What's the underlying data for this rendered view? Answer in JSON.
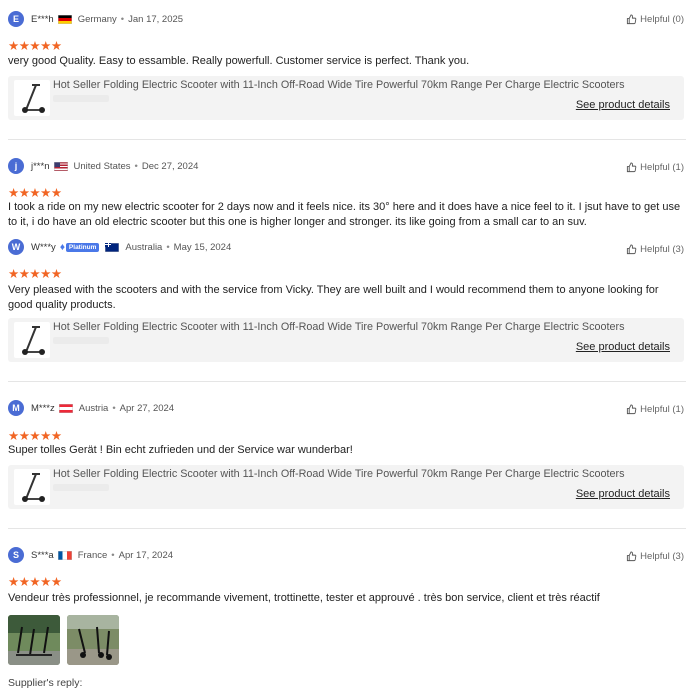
{
  "stars": "★★★★★",
  "colors": {
    "star": "#f16524",
    "avatar": "#4a6cd4",
    "platinum": "#4a78e8"
  },
  "product": {
    "title": "Hot Seller Folding Electric Scooter with 11-Inch Off-Road Wide Tire Powerful 70km Range Per Charge Electric Scooters",
    "details_link": "See product details"
  },
  "reviews": [
    {
      "initial": "E",
      "name": "E***h",
      "flag": "germany-flag",
      "country": "Germany",
      "date": "Jan 17, 2025",
      "helpful": "Helpful (0)",
      "rating": 5,
      "text": "very good Quality. Easy to essamble. Really powerfull. Customer service is perfect. Thank you."
    },
    {
      "initial": "j",
      "name": "j***n",
      "flag": "usa-flag",
      "country": "United States",
      "date": "Dec 27, 2024",
      "helpful": "Helpful (1)",
      "rating": 5,
      "text": "I took a ride on my new electric scooter for 2 days now and it feels nice. its 30° here and it does have a nice feel to it. I jsut have to get use to it, i do have an old electric scooter but this one is higher longer and stronger. its like going from a small car to an suv."
    },
    {
      "initial": "W",
      "name": "W***y",
      "badge": "Platinum",
      "flag": "australia-flag",
      "country": "Australia",
      "date": "May 15, 2024",
      "helpful": "Helpful (3)",
      "rating": 5,
      "text": "Very pleased with the scooters and with the service from Vicky. They are well built and I would recommend them to anyone looking for good quality products."
    },
    {
      "initial": "M",
      "name": "M***z",
      "flag": "austria-flag",
      "country": "Austria",
      "date": "Apr 27, 2024",
      "helpful": "Helpful (1)",
      "rating": 5,
      "text": "Super tolles Gerät ! Bin echt zufrieden und der Service war wunderbar!"
    },
    {
      "initial": "S",
      "name": "S***a",
      "flag": "france-flag",
      "country": "France",
      "date": "Apr 17, 2024",
      "helpful": "Helpful (3)",
      "rating": 5,
      "text": "Vendeur très professionnel, je recommande vivement, trottinette, tester et approuvé . très bon service, client et très réactif"
    }
  ],
  "supplier_reply_label": "Supplier's reply:"
}
